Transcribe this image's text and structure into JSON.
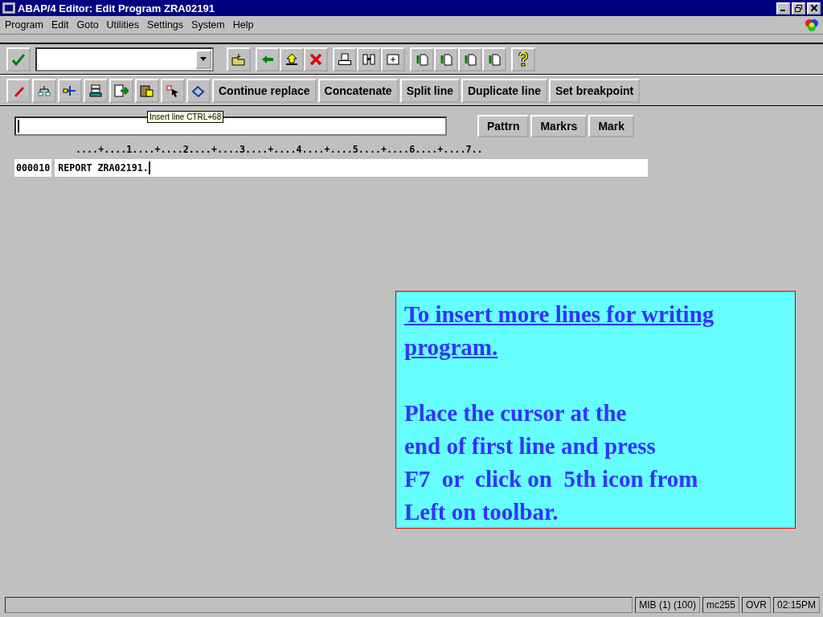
{
  "window": {
    "title": "ABAP/4 Editor: Edit Program ZRA02191"
  },
  "menu": [
    "Program",
    "Edit",
    "Goto",
    "Utilities",
    "Settings",
    "System",
    "Help"
  ],
  "application_toolbar": {
    "buttons": [
      "Continue replace",
      "Concatenate",
      "Split line",
      "Duplicate line",
      "Set breakpoint"
    ]
  },
  "tooltip": "Insert line  CTRL+68",
  "find_buttons": [
    "Pattrn",
    "Markrs",
    "Mark"
  ],
  "ruler": "....+....1....+....2....+....3....+....4....+....5....+....6....+....7..",
  "lines": [
    {
      "number": "000010",
      "code": "REPORT ZRA02191."
    }
  ],
  "callout": {
    "title": "To insert more  lines for writing program.",
    "lines": [
      "Place the cursor at the",
      "end of first line and press",
      "F7  or  click on  5th icon from",
      "Left on toolbar."
    ]
  },
  "status_bar": {
    "fields": [
      "MIB (1) (100)",
      "mc255",
      "OVR",
      "02:15PM"
    ]
  }
}
